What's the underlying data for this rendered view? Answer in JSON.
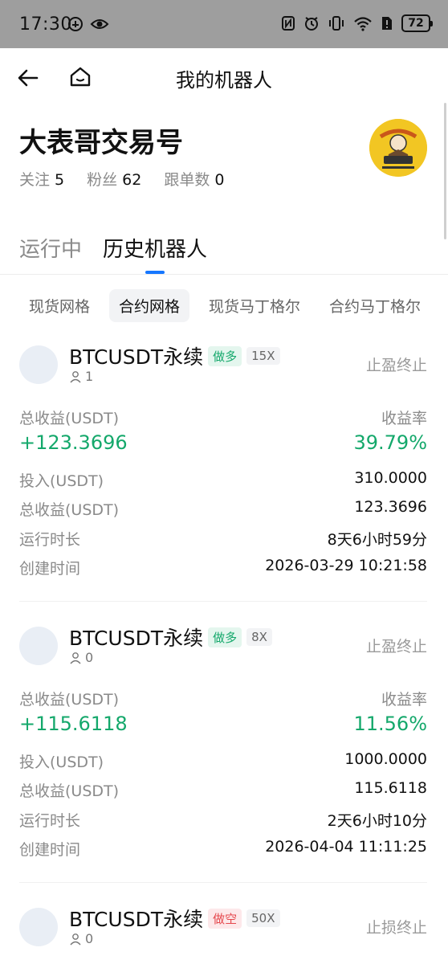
{
  "status_bar": {
    "time": "17:30",
    "battery": "72"
  },
  "nav": {
    "title": "我的机器人"
  },
  "profile": {
    "name": "大表哥交易号",
    "stats": [
      {
        "label": "关注",
        "value": "5"
      },
      {
        "label": "粉丝",
        "value": "62"
      },
      {
        "label": "跟单数",
        "value": "0"
      }
    ]
  },
  "main_tabs": [
    {
      "label": "运行中",
      "active": false
    },
    {
      "label": "历史机器人",
      "active": true
    }
  ],
  "sub_tabs": [
    {
      "label": "现货网格",
      "active": false
    },
    {
      "label": "合约网格",
      "active": true
    },
    {
      "label": "现货马丁格尔",
      "active": false
    },
    {
      "label": "合约马丁格尔",
      "active": false
    }
  ],
  "cards": [
    {
      "symbol": "BTCUSDT永续",
      "side": "做多",
      "leverage": "15X",
      "followers": "1",
      "status": "止盈终止",
      "pnl_label": "总收益(USDT)",
      "yield_label": "收益率",
      "pnl": "+123.3696",
      "yield": "39.79%",
      "rows": [
        {
          "label": "投入(USDT)",
          "value": "310.0000"
        },
        {
          "label": "总收益(USDT)",
          "value": "123.3696"
        },
        {
          "label": "运行时长",
          "value": "8天6小时59分"
        },
        {
          "label": "创建时间",
          "value": "2026-03-29 10:21:58"
        }
      ]
    },
    {
      "symbol": "BTCUSDT永续",
      "side": "做多",
      "leverage": "8X",
      "followers": "0",
      "status": "止盈终止",
      "pnl_label": "总收益(USDT)",
      "yield_label": "收益率",
      "pnl": "+115.6118",
      "yield": "11.56%",
      "rows": [
        {
          "label": "投入(USDT)",
          "value": "1000.0000"
        },
        {
          "label": "总收益(USDT)",
          "value": "115.6118"
        },
        {
          "label": "运行时长",
          "value": "2天6小时10分"
        },
        {
          "label": "创建时间",
          "value": "2026-04-04 11:11:25"
        }
      ]
    },
    {
      "symbol": "BTCUSDT永续",
      "side": "做空",
      "leverage": "50X",
      "followers": "0",
      "status": "止损终止"
    }
  ],
  "colors": {
    "profit_green": "#14a86b",
    "short_red": "#e5484d",
    "accent_blue": "#1677ff"
  }
}
